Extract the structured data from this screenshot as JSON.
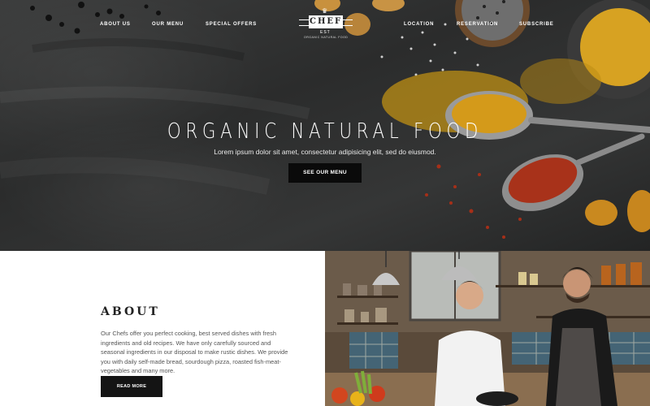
{
  "nav": {
    "items": [
      "ABOUT US",
      "OUR MENU",
      "SPECIAL OFFERS",
      "LOCATION",
      "RESERVATION",
      "SUBSCRIBE"
    ]
  },
  "logo": {
    "name": "CHEF",
    "est": "EST",
    "tagline": "ORGANIC NATURAL FOOD"
  },
  "hero": {
    "title": "ORGANIC NATURAL FOOD",
    "subtitle": "Lorem ipsum dolor sit amet, consectetur adipisicing elit, sed do eiusmod.",
    "button": "SEE OUR MENU"
  },
  "about": {
    "title": "ABOUT",
    "text": "Our Chefs offer you perfect cooking, best served dishes with fresh ingredients and old recipes. We have only carefully sourced and seasonal ingredients in our disposal to make rustic dishes. We provide you with daily self-made bread, sourdough pizza, roasted fish-meat-vegetables and many more.",
    "button": "READ MORE"
  },
  "colors": {
    "slate": "#2e2f2f",
    "button_bg": "#0a0a0a",
    "turmeric": "#d9a11a",
    "chili": "#b2361c"
  }
}
